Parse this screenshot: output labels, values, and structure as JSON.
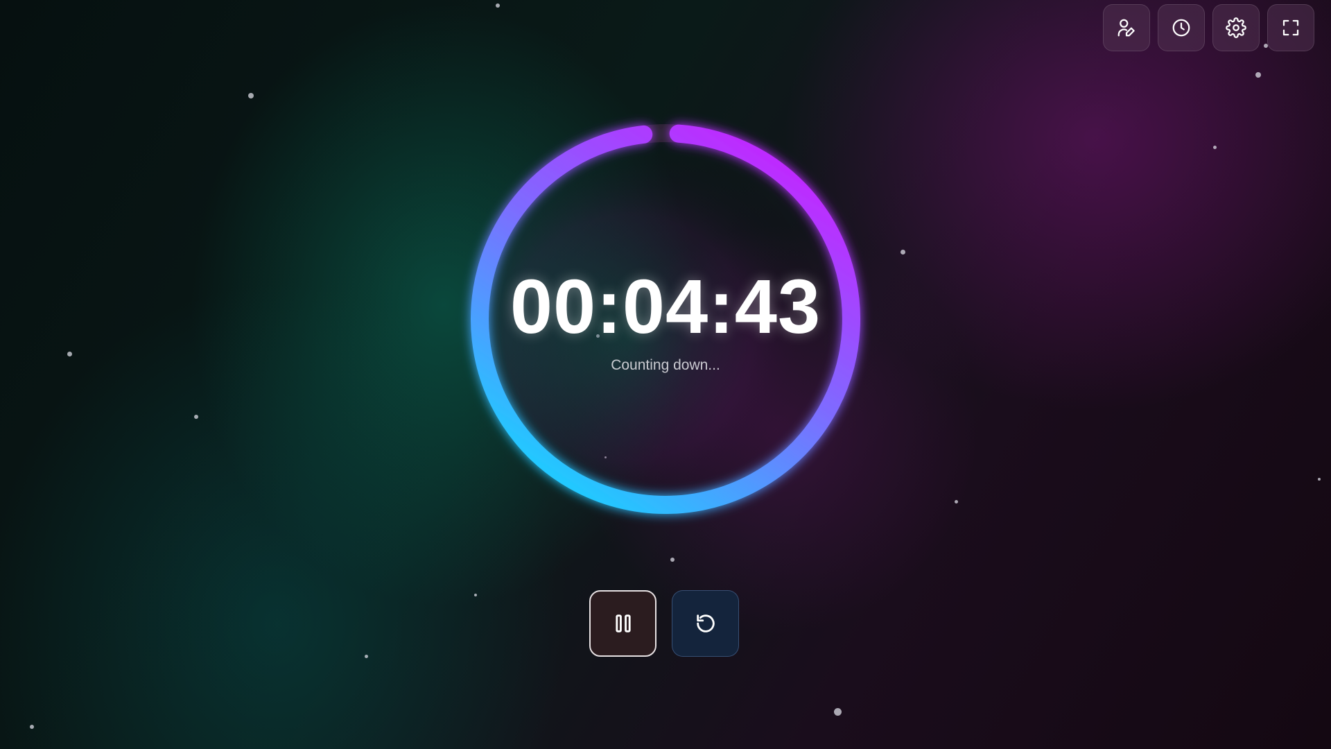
{
  "timer": {
    "display": "00:04:43",
    "status": "Counting down...",
    "progress_remaining": 0.97
  },
  "toolbar": {
    "items": [
      {
        "name": "user-edit",
        "icon": "user-edit-icon"
      },
      {
        "name": "history",
        "icon": "clock-icon"
      },
      {
        "name": "settings",
        "icon": "gear-icon"
      },
      {
        "name": "fullscreen",
        "icon": "fullscreen-icon"
      }
    ]
  },
  "controls": {
    "pause_icon": "pause-icon",
    "reset_icon": "reset-icon"
  },
  "colors": {
    "ring_start": "#c424ff",
    "ring_mid": "#7d6cff",
    "ring_end": "#23c8ff",
    "track": "#2a2430"
  }
}
